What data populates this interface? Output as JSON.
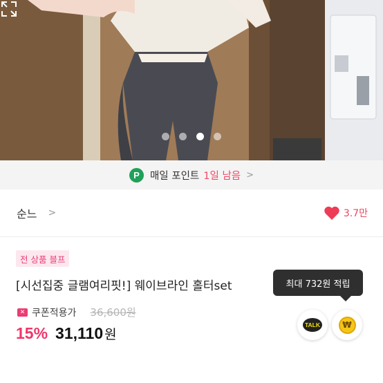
{
  "gallery": {
    "slide_count": 4,
    "active_index": 2,
    "expand_icon": "expand-icon"
  },
  "points_banner": {
    "badge": "P",
    "text": "매일 포인트",
    "accent_text": "1일 남음",
    "accent_color": "#f04867",
    "badge_color": "#20a05a"
  },
  "shop": {
    "name": "순느",
    "likes": "3.7만",
    "like_color": "#e8485f"
  },
  "product": {
    "promo_tag": "전 상품 블프",
    "title": "[시선집중 글램여리핏!] 웨이브라인 홀터set",
    "coupon_label": "쿠폰적용가",
    "original_price": "36,600원",
    "discount": "15%",
    "price": "31,110",
    "currency": "원"
  },
  "reward_tooltip": {
    "text": "최대 732원 적립"
  },
  "actions": {
    "talk_label": "TALK",
    "coin_label": "₩"
  }
}
